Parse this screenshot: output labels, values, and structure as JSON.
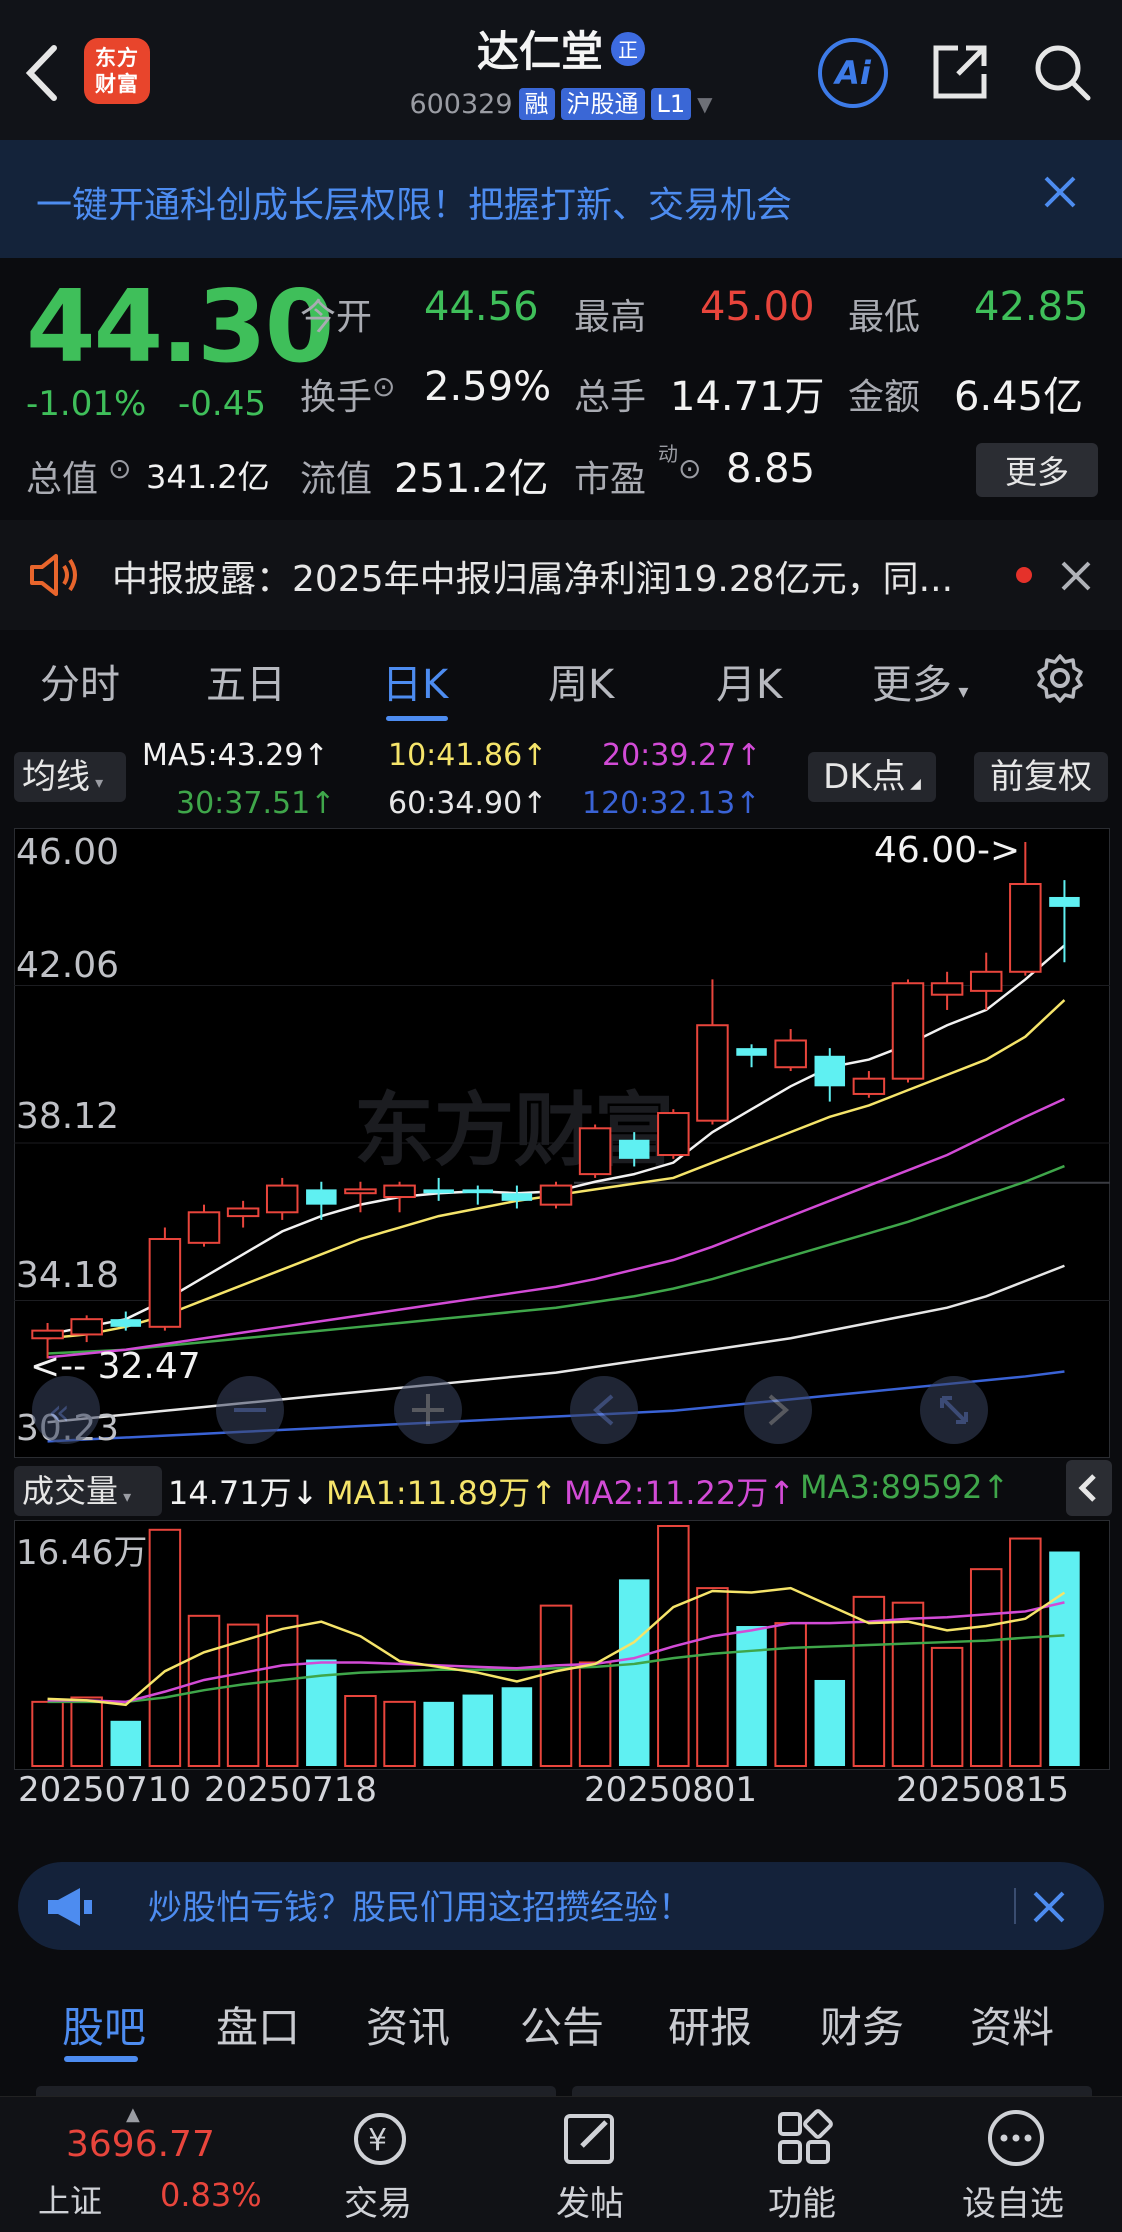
{
  "header": {
    "logo_text": "东方财富",
    "stock_name": "达仁堂",
    "zheng_badge": "正",
    "stock_code": "600329",
    "tags": [
      "融",
      "沪股通",
      "L1"
    ]
  },
  "promo": {
    "text": "一键开通科创成长层权限！把握打新、交易机会"
  },
  "quote": {
    "price": "44.30",
    "pct_change": "-1.01%",
    "abs_change": "-0.45",
    "open_label": "今开",
    "open": "44.56",
    "high_label": "最高",
    "high": "45.00",
    "low_label": "最低",
    "low": "42.85",
    "turnover_label": "换手",
    "turnover": "2.59%",
    "volume_label": "总手",
    "volume": "14.71万",
    "amount_label": "金额",
    "amount": "6.45亿",
    "mktcap_label": "总值",
    "mktcap": "341.2亿",
    "float_label": "流值",
    "float_cap": "251.2亿",
    "pe_label": "市盈",
    "pe_sup": "动",
    "pe": "8.85",
    "more": "更多"
  },
  "notice": {
    "text": "中报披露：2025年中报归属净利润19.28亿元，同..."
  },
  "chart_tabs": [
    "分时",
    "五日",
    "日K",
    "周K",
    "月K",
    "更多"
  ],
  "ma_header": {
    "select": "均线",
    "ma5": "MA5:43.29↑",
    "ma10": "10:41.86↑",
    "ma20": "20:39.27↑",
    "ma30": "30:37.51↑",
    "ma60": "60:34.90↑",
    "ma120": "120:32.13↑",
    "dk": "DK点",
    "fuquan": "前复权"
  },
  "kchart_labels": {
    "y_ticks": [
      "46.00",
      "42.06",
      "38.12",
      "34.18",
      "30.23"
    ],
    "max_marker": "46.00->",
    "min_marker": "<-- 32.47"
  },
  "volume": {
    "select": "成交量",
    "vol": "14.71万↓",
    "ma1": "MA1:11.89万↑",
    "ma2": "MA2:11.22万↑",
    "ma3": "MA3:89592↑",
    "y_top": "16.46万"
  },
  "dates": [
    "20250710",
    "20250718",
    "20250801",
    "20250815"
  ],
  "ad": {
    "text": "炒股怕亏钱？股民们用这招攒经验！"
  },
  "bottom_tabs": [
    "股吧",
    "盘口",
    "资讯",
    "公告",
    "研报",
    "财务",
    "资料"
  ],
  "bottom_nav": {
    "index_value": "3696.77",
    "index_name": "上证",
    "index_change": "0.83%",
    "items": [
      "交易",
      "发帖",
      "功能",
      "设自选"
    ]
  },
  "colors": {
    "up": "#e8453c",
    "down": "#5ff0f2",
    "accent": "#4d8cf0"
  },
  "chart_data": {
    "type": "candlestick",
    "y_range": [
      30.23,
      46.0
    ],
    "candles": [
      {
        "o": 33.0,
        "h": 33.4,
        "l": 32.47,
        "c": 33.2
      },
      {
        "o": 33.1,
        "h": 33.6,
        "l": 32.9,
        "c": 33.5
      },
      {
        "o": 33.5,
        "h": 33.7,
        "l": 33.2,
        "c": 33.3
      },
      {
        "o": 33.3,
        "h": 35.9,
        "l": 33.2,
        "c": 35.6
      },
      {
        "o": 35.5,
        "h": 36.5,
        "l": 35.4,
        "c": 36.3
      },
      {
        "o": 36.2,
        "h": 36.6,
        "l": 35.9,
        "c": 36.4
      },
      {
        "o": 36.3,
        "h": 37.2,
        "l": 36.1,
        "c": 37.0
      },
      {
        "o": 36.9,
        "h": 37.1,
        "l": 36.1,
        "c": 36.5
      },
      {
        "o": 36.8,
        "h": 37.1,
        "l": 36.3,
        "c": 36.9
      },
      {
        "o": 36.7,
        "h": 37.1,
        "l": 36.3,
        "c": 37.0
      },
      {
        "o": 36.9,
        "h": 37.2,
        "l": 36.6,
        "c": 36.8
      },
      {
        "o": 36.9,
        "h": 37.0,
        "l": 36.5,
        "c": 36.8
      },
      {
        "o": 36.8,
        "h": 37.0,
        "l": 36.4,
        "c": 36.6
      },
      {
        "o": 36.5,
        "h": 37.1,
        "l": 36.4,
        "c": 37.0
      },
      {
        "o": 37.3,
        "h": 38.6,
        "l": 37.2,
        "c": 38.5
      },
      {
        "o": 38.2,
        "h": 38.4,
        "l": 37.5,
        "c": 37.7
      },
      {
        "o": 37.8,
        "h": 39.0,
        "l": 37.7,
        "c": 38.9
      },
      {
        "o": 38.7,
        "h": 42.4,
        "l": 38.6,
        "c": 41.2
      },
      {
        "o": 40.6,
        "h": 40.7,
        "l": 40.1,
        "c": 40.4
      },
      {
        "o": 40.1,
        "h": 41.1,
        "l": 40.0,
        "c": 40.8
      },
      {
        "o": 40.4,
        "h": 40.6,
        "l": 39.2,
        "c": 39.6
      },
      {
        "o": 39.4,
        "h": 40.0,
        "l": 39.3,
        "c": 39.8
      },
      {
        "o": 39.8,
        "h": 42.4,
        "l": 39.7,
        "c": 42.3
      },
      {
        "o": 42.0,
        "h": 42.6,
        "l": 41.6,
        "c": 42.3
      },
      {
        "o": 42.1,
        "h": 43.1,
        "l": 41.6,
        "c": 42.6
      },
      {
        "o": 42.6,
        "h": 46.0,
        "l": 42.5,
        "c": 44.9
      },
      {
        "o": 44.56,
        "h": 45.0,
        "l": 42.85,
        "c": 44.3
      }
    ],
    "ma5": [
      33.1,
      33.3,
      33.5,
      34.0,
      34.6,
      35.2,
      35.8,
      36.2,
      36.5,
      36.7,
      36.8,
      36.85,
      36.8,
      36.85,
      37.1,
      37.3,
      37.6,
      38.4,
      39.0,
      39.6,
      40.1,
      40.3,
      40.7,
      41.2,
      41.6,
      42.4,
      43.29
    ],
    "ma10": [
      33.0,
      33.1,
      33.3,
      33.6,
      34.0,
      34.4,
      34.8,
      35.2,
      35.6,
      35.9,
      36.2,
      36.4,
      36.6,
      36.75,
      36.9,
      37.05,
      37.2,
      37.6,
      38.0,
      38.4,
      38.8,
      39.1,
      39.5,
      39.9,
      40.3,
      40.9,
      41.86
    ],
    "ma20": [
      32.5,
      32.6,
      32.7,
      32.85,
      33.0,
      33.15,
      33.3,
      33.45,
      33.6,
      33.75,
      33.9,
      34.05,
      34.2,
      34.35,
      34.55,
      34.8,
      35.05,
      35.4,
      35.8,
      36.2,
      36.6,
      37.0,
      37.4,
      37.8,
      38.3,
      38.8,
      39.27
    ],
    "ma30": [
      32.6,
      32.65,
      32.7,
      32.8,
      32.9,
      33.0,
      33.1,
      33.2,
      33.3,
      33.4,
      33.5,
      33.6,
      33.7,
      33.8,
      33.95,
      34.1,
      34.3,
      34.55,
      34.85,
      35.15,
      35.45,
      35.75,
      36.05,
      36.4,
      36.75,
      37.1,
      37.51
    ],
    "ma60": [
      30.8,
      30.9,
      31.0,
      31.1,
      31.2,
      31.3,
      31.4,
      31.5,
      31.6,
      31.7,
      31.8,
      31.9,
      32.0,
      32.1,
      32.25,
      32.4,
      32.55,
      32.7,
      32.85,
      33.0,
      33.2,
      33.4,
      33.6,
      33.8,
      34.1,
      34.5,
      34.9
    ],
    "ma120": [
      30.3,
      30.35,
      30.4,
      30.45,
      30.5,
      30.55,
      30.6,
      30.65,
      30.7,
      30.75,
      30.8,
      30.85,
      30.9,
      30.95,
      31.0,
      31.05,
      31.1,
      31.2,
      31.3,
      31.4,
      31.5,
      31.6,
      31.7,
      31.8,
      31.9,
      32.0,
      32.13
    ],
    "volume": [
      4.4,
      4.7,
      3.1,
      16.2,
      10.3,
      9.7,
      10.3,
      7.3,
      4.8,
      4.4,
      4.4,
      4.9,
      5.4,
      11.0,
      7.1,
      12.8,
      16.46,
      12.2,
      9.6,
      9.8,
      5.9,
      11.6,
      11.2,
      8.1,
      13.5,
      15.6,
      14.71
    ],
    "vol_ma1": [
      4.6,
      4.5,
      4.2,
      6.5,
      7.8,
      8.6,
      9.4,
      9.9,
      8.9,
      7.2,
      6.8,
      6.4,
      5.8,
      6.5,
      7.0,
      8.5,
      10.9,
      12.0,
      11.9,
      12.2,
      11.0,
      9.8,
      9.9,
      9.3,
      9.6,
      10.1,
      11.89
    ],
    "vol_ma2": [
      4.5,
      4.5,
      4.4,
      5.1,
      5.9,
      6.4,
      6.9,
      7.1,
      7.1,
      7.0,
      6.9,
      6.8,
      6.7,
      6.9,
      7.0,
      7.4,
      8.2,
      8.9,
      9.3,
      9.8,
      9.8,
      9.9,
      10.1,
      10.2,
      10.4,
      10.6,
      11.22
    ],
    "vol_ma3": [
      4.4,
      4.4,
      4.4,
      4.7,
      5.2,
      5.6,
      5.9,
      6.2,
      6.4,
      6.5,
      6.6,
      6.6,
      6.6,
      6.7,
      6.8,
      7.0,
      7.4,
      7.7,
      7.9,
      8.1,
      8.2,
      8.3,
      8.4,
      8.5,
      8.6,
      8.8,
      8.96
    ]
  }
}
